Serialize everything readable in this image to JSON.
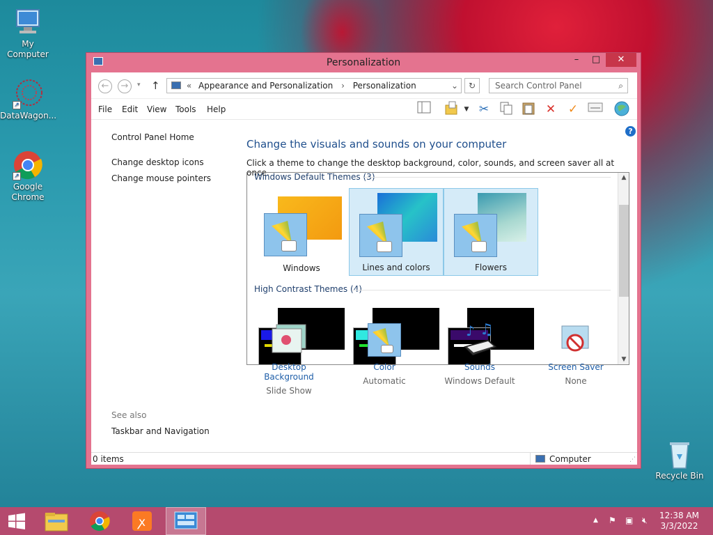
{
  "desktop": {
    "icons": [
      {
        "label": "My Computer"
      },
      {
        "label": "DataWagon..."
      },
      {
        "label": "Google Chrome"
      },
      {
        "label": "Recycle Bin"
      }
    ]
  },
  "window": {
    "title": "Personalization",
    "controls": {
      "minimize": "–",
      "maximize": "□",
      "close": "✕"
    },
    "address": {
      "prefix": "«",
      "crumbs": [
        "Appearance and Personalization",
        "Personalization"
      ],
      "separator": "›"
    },
    "search": {
      "placeholder": "Search Control Panel"
    },
    "menu": [
      "File",
      "Edit",
      "View",
      "Tools",
      "Help"
    ],
    "toolbar_icons": [
      "preview-pane-icon",
      "folder-options-icon",
      "dropdown-icon",
      "cut-icon",
      "copy-icon",
      "paste-icon",
      "delete-icon",
      "properties-icon",
      "view-icon",
      "globe-icon"
    ],
    "left_pane": {
      "links": [
        "Control Panel Home",
        "Change desktop icons",
        "Change mouse pointers"
      ],
      "see_also_label": "See also",
      "see_also_links": [
        "Taskbar and Navigation"
      ]
    },
    "main": {
      "heading": "Change the visuals and sounds on your computer",
      "subtext": "Click a theme to change the desktop background, color, sounds, and screen saver all at once.",
      "groups": [
        {
          "title": "Windows Default Themes (3)",
          "themes": [
            "Windows",
            "Lines and colors",
            "Flowers"
          ]
        },
        {
          "title": "High Contrast Themes (4)"
        }
      ],
      "settings": [
        {
          "title": "Desktop Background",
          "value": "Slide Show"
        },
        {
          "title": "Color",
          "value": "Automatic"
        },
        {
          "title": "Sounds",
          "value": "Windows Default"
        },
        {
          "title": "Screen Saver",
          "value": "None"
        }
      ]
    },
    "status": {
      "items": "0 items",
      "location": "Computer"
    }
  },
  "taskbar": {
    "clock_time": "12:38 AM",
    "clock_date": "3/3/2022"
  },
  "colors": {
    "window_frame": "#e4738f",
    "close_button": "#c7364a",
    "taskbar": "#b54a6e",
    "heading": "#1e4e8c",
    "link_blue": "#1e5ea8",
    "selection": "#d5ebf8"
  }
}
